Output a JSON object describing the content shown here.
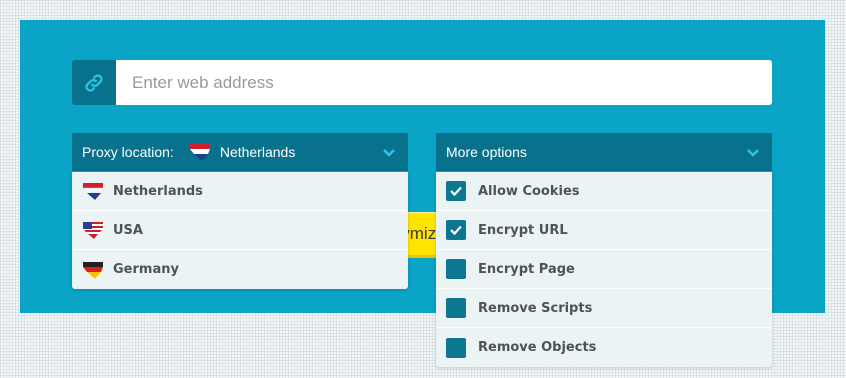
{
  "url_bar": {
    "placeholder": "Enter web address",
    "icon": "link-icon"
  },
  "go_button": {
    "label_visible": "onymize"
  },
  "location": {
    "label": "Proxy location:",
    "selected": "Netherlands",
    "options": [
      {
        "label": "Netherlands",
        "flag": "flag-netherlands"
      },
      {
        "label": "USA",
        "flag": "flag-usa"
      },
      {
        "label": "Germany",
        "flag": "flag-germany"
      }
    ]
  },
  "options": {
    "label": "More options",
    "items": [
      {
        "label": "Allow Cookies",
        "checked": true
      },
      {
        "label": "Encrypt URL",
        "checked": true
      },
      {
        "label": "Encrypt Page",
        "checked": false
      },
      {
        "label": "Remove Scripts",
        "checked": false
      },
      {
        "label": "Remove Objects",
        "checked": false
      }
    ]
  },
  "colors": {
    "panel": "#0aa4c6",
    "dark_accent": "#08718c",
    "button": "#ffe400",
    "menu_bg": "#ecf3f5"
  }
}
